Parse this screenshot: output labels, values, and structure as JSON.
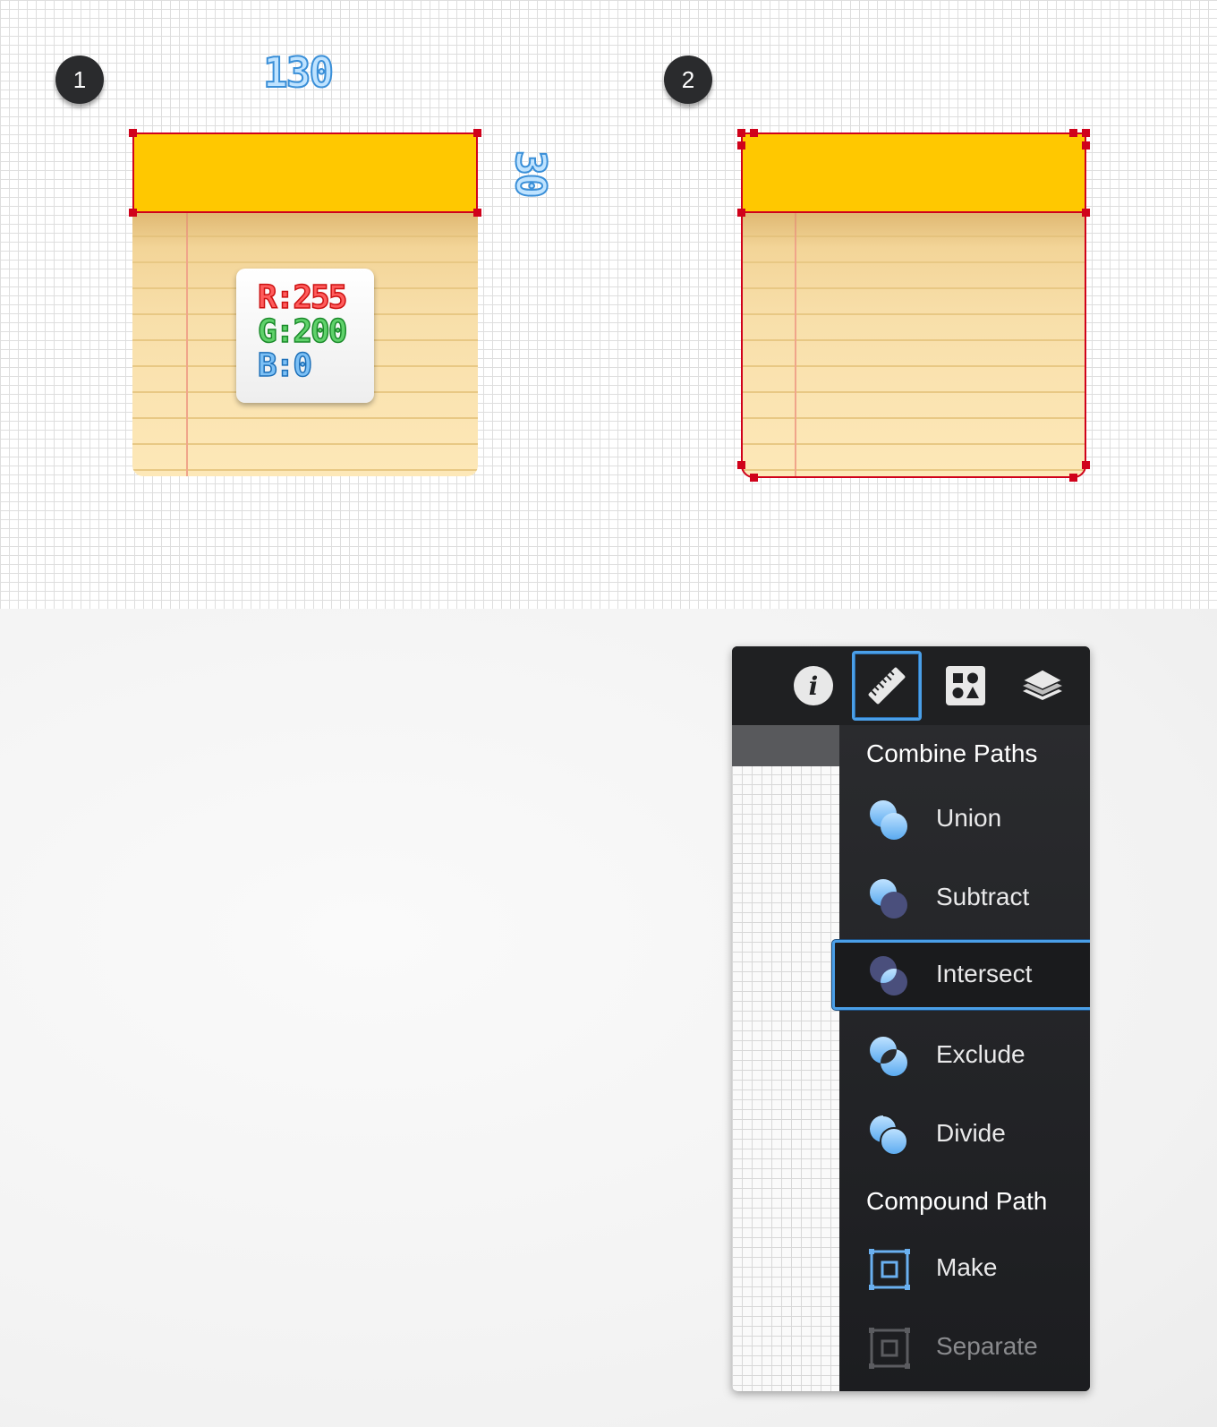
{
  "steps": {
    "one": "1",
    "two": "2"
  },
  "dimensions": {
    "width": "130",
    "height": "30"
  },
  "color_values": {
    "r": "R:255",
    "g": "G:200",
    "b": "B:0"
  },
  "colors": {
    "header_yellow": "#ffc800",
    "selection_red": "#d0021b",
    "accent_blue": "#4a9fe8",
    "panel_dark": "#1f2022"
  },
  "panel": {
    "tabs": [
      {
        "icon": "info-icon",
        "active": false
      },
      {
        "icon": "ruler-icon",
        "active": true
      },
      {
        "icon": "shapes-icon",
        "active": false
      },
      {
        "icon": "layers-icon",
        "active": false
      }
    ],
    "combine_heading": "Combine Paths",
    "combine_items": [
      {
        "label": "Union",
        "icon": "union-icon"
      },
      {
        "label": "Subtract",
        "icon": "subtract-icon"
      },
      {
        "label": "Intersect",
        "icon": "intersect-icon",
        "selected": true
      },
      {
        "label": "Exclude",
        "icon": "exclude-icon"
      },
      {
        "label": "Divide",
        "icon": "divide-icon"
      }
    ],
    "compound_heading": "Compound Path",
    "compound_items": [
      {
        "label": "Make",
        "icon": "make-icon"
      },
      {
        "label": "Separate",
        "icon": "separate-icon",
        "disabled": true
      }
    ]
  }
}
